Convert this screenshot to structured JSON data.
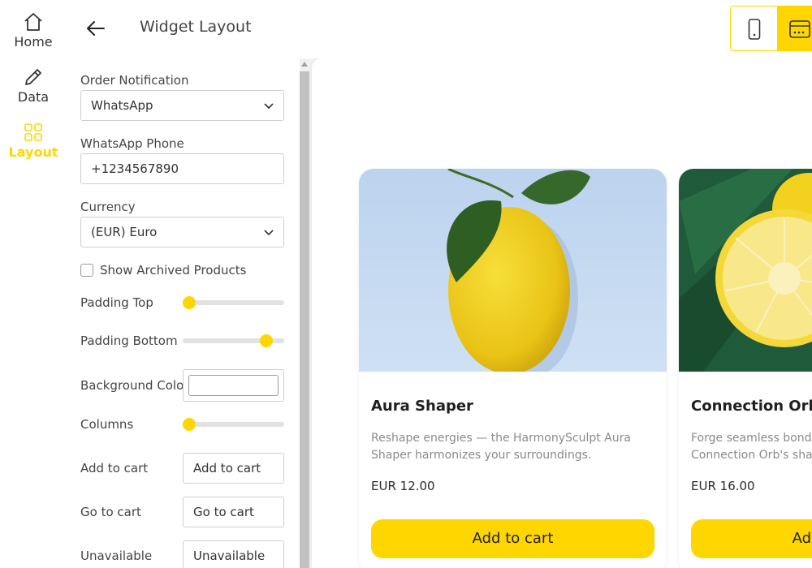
{
  "nav": {
    "items": [
      {
        "label": "Home",
        "icon": "home-icon"
      },
      {
        "label": "Data",
        "icon": "pencil-icon"
      },
      {
        "label": "Layout",
        "icon": "grid-icon",
        "active": true
      }
    ]
  },
  "header": {
    "title": "Widget Layout",
    "device_options": [
      "mobile",
      "desktop"
    ],
    "selected_device": "desktop"
  },
  "settings": {
    "order_notification": {
      "label": "Order Notification",
      "value": "WhatsApp"
    },
    "whatsapp_phone": {
      "label": "WhatsApp Phone",
      "value": "+1234567890"
    },
    "currency": {
      "label": "Currency",
      "value": "(EUR) Euro"
    },
    "show_archived": {
      "label": "Show Archived Products",
      "checked": false
    },
    "padding_top": {
      "label": "Padding Top",
      "value_fraction": 0.0
    },
    "padding_bottom": {
      "label": "Padding Bottom",
      "value_fraction": 0.87
    },
    "background_color": {
      "label": "Background Color",
      "value": "#ffffff"
    },
    "columns": {
      "label": "Columns",
      "value_fraction": 0.0
    },
    "add_to_cart": {
      "label": "Add to cart",
      "value": "Add to cart"
    },
    "go_to_cart": {
      "label": "Go to cart",
      "value": "Go to cart"
    },
    "unavailable": {
      "label": "Unavailable",
      "value": "Unavailable"
    }
  },
  "products": [
    {
      "title": "Aura Shaper",
      "desc_line1": "Reshape energies — the HarmonySculpt Aura",
      "desc_line2": "Shaper harmonizes your surroundings.",
      "price": "EUR 12.00",
      "button": "Add to cart"
    },
    {
      "title": "Connection Orb",
      "desc_line1": "Forge seamless bonds",
      "desc_line2": "Connection Orb's shar",
      "price": "EUR 16.00",
      "button": "Add to cart"
    }
  ],
  "colors": {
    "accent": "#ffd600",
    "text": "#2b2b2b",
    "muted": "#8a8a8a"
  }
}
